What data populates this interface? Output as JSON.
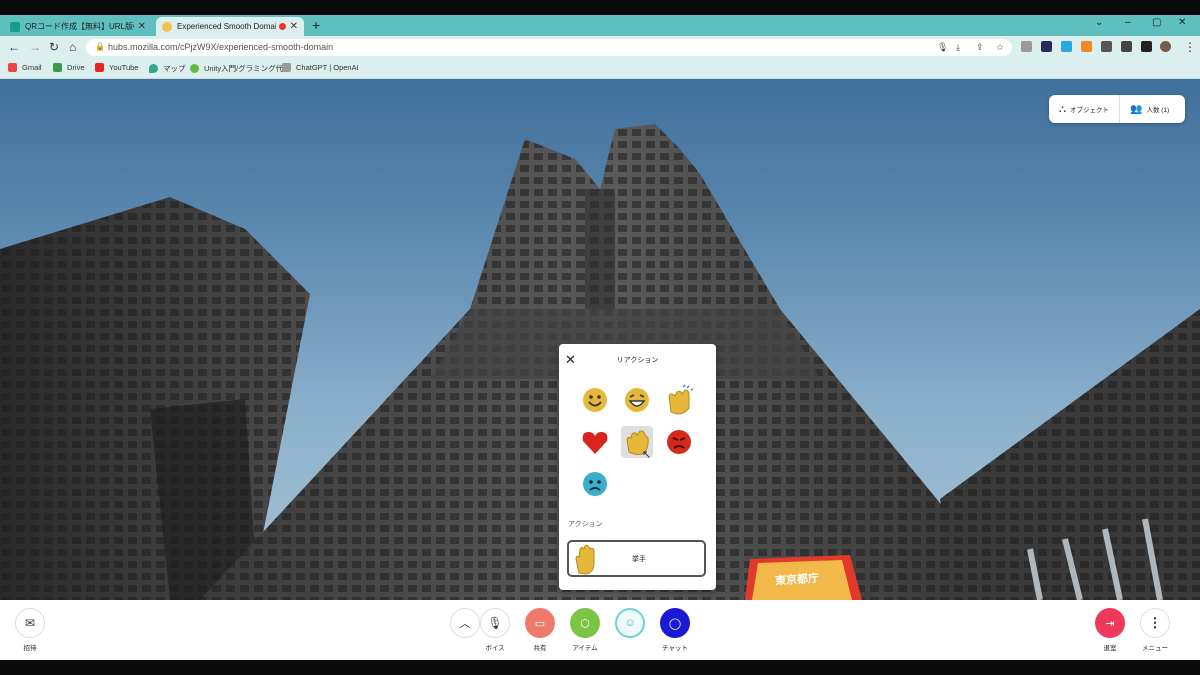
{
  "browser": {
    "tabs": [
      {
        "title": "QRコード作成【無料】URL版QRコード",
        "active": false
      },
      {
        "title": "Experienced Smooth Domain",
        "active": true
      }
    ],
    "url": "hubs.mozilla.com/cPjzW9X/experienced-smooth-domain",
    "bookmarks": [
      "Gmail",
      "Drive",
      "YouTube",
      "マップ",
      "Unity入門/グラミング代...",
      "ChatGPT | OpenAI"
    ]
  },
  "hud": {
    "objects_label": "オブジェクト",
    "people_label": "人数 (1)"
  },
  "reactions": {
    "title": "リアクション",
    "emojis": [
      "smile-emoji",
      "laugh-emoji",
      "clap-emoji",
      "heart-emoji",
      "wave-emoji",
      "angry-emoji",
      "sad-emoji"
    ],
    "actions_label": "アクション",
    "raise_hand_label": "挙手"
  },
  "sign_text": "東京都庁",
  "bottom": {
    "invite": "招待",
    "voice": "ボイス",
    "share": "共有",
    "item": "アイテム",
    "chat": "チャット",
    "leave": "退室",
    "menu": "メニュー"
  },
  "colors": {
    "tabstrip": "#5fbfbf",
    "share": "#f07a6a",
    "item": "#7cc444",
    "react": "#39b7b0",
    "chat": "#1a1ad6",
    "leave": "#ee3a5a"
  }
}
